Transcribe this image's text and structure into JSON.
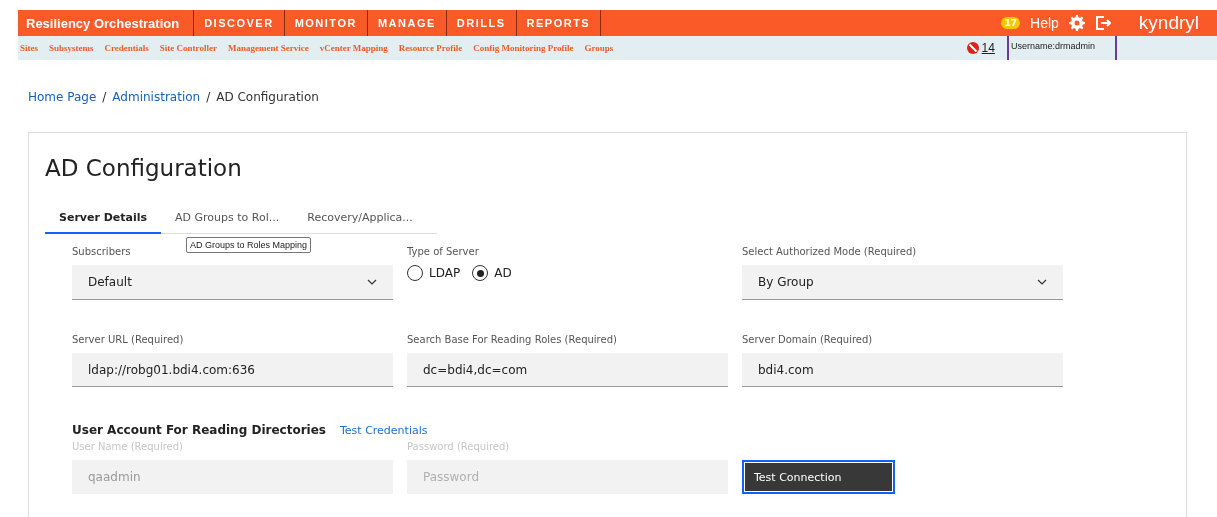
{
  "header": {
    "brand": "Resiliency Orchestration",
    "nav": [
      {
        "label": "DISCOVER"
      },
      {
        "label": "MONITOR"
      },
      {
        "label": "MANAGE"
      },
      {
        "label": "DRILLS"
      },
      {
        "label": "REPORTS"
      }
    ],
    "notification_count": "17",
    "help": "Help",
    "logo": "kyndryl"
  },
  "subnav": {
    "items": [
      "Sites",
      "Subsystems",
      "Credentials",
      "Site Controller",
      "Management Service",
      "vCenter Mapping",
      "Resource Profile",
      "Config Monitoring Profile",
      "Groups"
    ],
    "alert_count": "14",
    "username": "Username:drmadmin"
  },
  "breadcrumb": [
    "Home Page",
    "Administration",
    "AD Configuration"
  ],
  "breadcrumb_separator": "/",
  "page_title": "AD Configuration",
  "tabs": [
    {
      "label": "Server Details",
      "selected": true
    },
    {
      "label": "AD Groups to Rol...",
      "selected": false
    },
    {
      "label": "Recovery/Applica...",
      "selected": false
    }
  ],
  "tooltip": "AD Groups to Roles Mapping",
  "rows": [
    [
      {
        "kind": "select",
        "label": "Subscribers",
        "value": "Default"
      },
      {
        "kind": "radio",
        "label": "Type of Server",
        "options": [
          {
            "label": "LDAP",
            "selected": false
          },
          {
            "label": "AD",
            "selected": true
          }
        ]
      },
      {
        "kind": "select",
        "label": "Select Authorized Mode (Required)",
        "value": "By Group"
      }
    ],
    [
      {
        "kind": "text",
        "label": "Server URL (Required)",
        "value": "ldap://robg01.bdi4.com:636",
        "disabled": false
      },
      {
        "kind": "text",
        "label": "Search Base For Reading Roles (Required)",
        "value": "dc=bdi4,dc=com",
        "disabled": false
      },
      {
        "kind": "text",
        "label": "Server Domain (Required)",
        "value": "bdi4.com",
        "disabled": false
      }
    ]
  ],
  "account": {
    "heading": "User Account For Reading Directories",
    "link": "Test Credentials",
    "fields": [
      {
        "kind": "text",
        "label": "User Name (Required)",
        "value": "qaadmin",
        "disabled": true
      },
      {
        "kind": "password",
        "label": "Password (Required)",
        "placeholder": "Password",
        "disabled": true
      }
    ],
    "button": "Test Connection"
  }
}
